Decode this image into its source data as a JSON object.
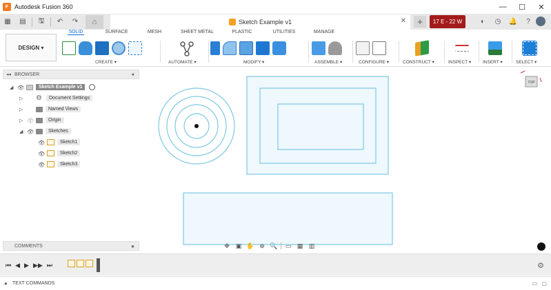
{
  "window": {
    "title": "Autodesk Fusion 360",
    "controls": [
      "—",
      "☐",
      "✕"
    ]
  },
  "document": {
    "tab_title": "Sketch Example v1",
    "close_glyph": "✕",
    "plus_glyph": "+",
    "job_status": "17 E - 22 W"
  },
  "quick_access": {
    "grid_glyph": "▦",
    "file_glyph": "▤",
    "save_glyph": "🖫",
    "undo_glyph": "↶",
    "redo_glyph": "↷",
    "home_glyph": "⌂"
  },
  "ribbon": {
    "workspace": "DESIGN ▾",
    "tabs": [
      "SOLID",
      "SURFACE",
      "MESH",
      "SHEET METAL",
      "PLASTIC",
      "UTILITIES",
      "MANAGE"
    ],
    "groups": [
      {
        "label": "CREATE ▾"
      },
      {
        "label": "AUTOMATE ▾"
      },
      {
        "label": "MODIFY ▾"
      },
      {
        "label": "ASSEMBLE ▾"
      },
      {
        "label": "CONFIGURE ▾"
      },
      {
        "label": "CONSTRUCT ▾"
      },
      {
        "label": "INSPECT ▾"
      },
      {
        "label": "INSERT ▾"
      },
      {
        "label": "SELECT ▾"
      }
    ]
  },
  "browser": {
    "header": "BROWSER",
    "collapse_glyph": "◂◂",
    "pin_glyph": "●",
    "root": "Sketch Example v1",
    "items": [
      {
        "label": "Document Settings"
      },
      {
        "label": "Named Views"
      },
      {
        "label": "Origin"
      },
      {
        "label": "Sketches"
      }
    ],
    "sketches": [
      "Sketch1",
      "Sketch2",
      "Sketch3"
    ]
  },
  "comments": {
    "header": "COMMENTS",
    "add_glyph": "●"
  },
  "text_commands": {
    "label": "TEXT COMMANDS",
    "collapse_glyph": "●"
  },
  "timeline": {
    "controls": [
      "⏮",
      "◀",
      "▶",
      "▶▶",
      "⏭"
    ]
  },
  "viewcube": {
    "face": "TOP"
  },
  "colors": {
    "accent": "#0a6ad6",
    "sketch_line": "#7ec8e3",
    "sketch_fill": "#eef8fd",
    "job_badge": "#a31b1b"
  }
}
